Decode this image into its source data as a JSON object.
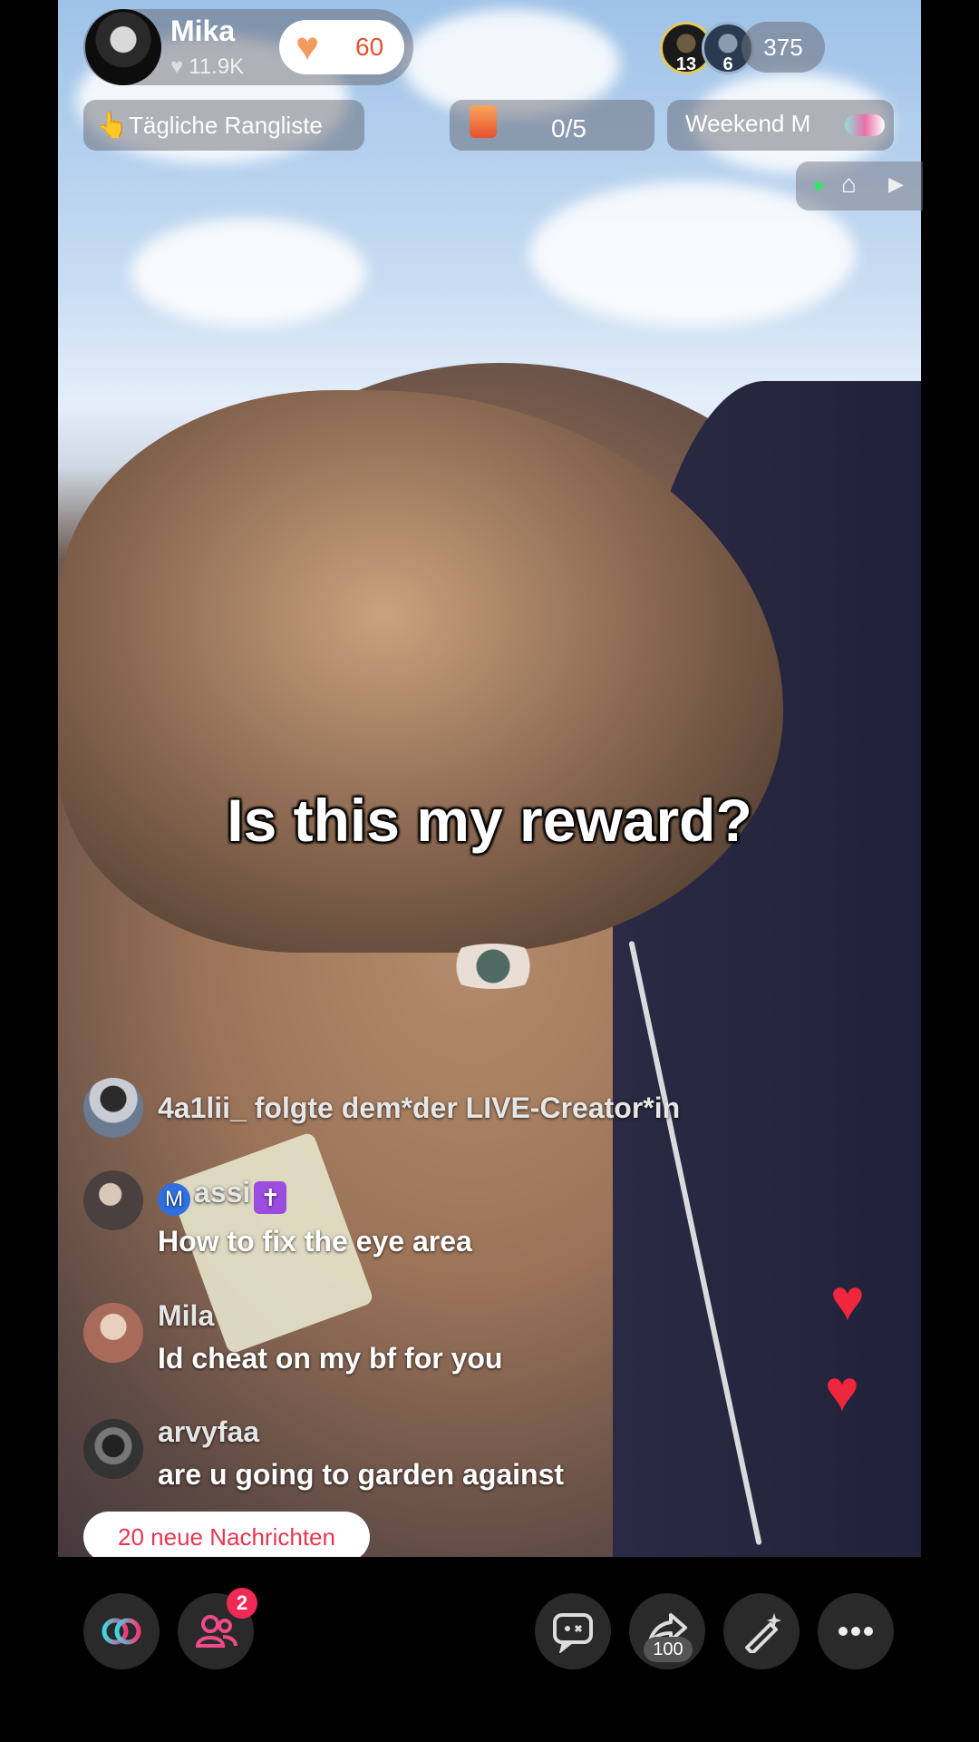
{
  "host": {
    "name": "Mika",
    "likes": "11.9K",
    "like_count": "60"
  },
  "viewers": {
    "top1_rank": "13",
    "top2_rank": "6",
    "count": "375"
  },
  "chips": {
    "ranking": "Tägliche Rangliste",
    "task_progress": "0/5",
    "weekend": "Weekend M"
  },
  "caption": "Is this my reward?",
  "comments": [
    {
      "user": "4a1lii_",
      "msg": "folgte dem*der LIVE-Creator*in"
    },
    {
      "user": "assi",
      "badge": "M",
      "msg": "How to fix the eye area"
    },
    {
      "user": "Mila",
      "msg": "Id cheat on my bf for you"
    },
    {
      "user": "arvyfaa",
      "msg": "are u going to garden against"
    }
  ],
  "new_messages": "20 neue Nachrichten",
  "bottom": {
    "friends_badge": "2",
    "share_count": "100"
  },
  "colors": {
    "accent_red": "#e8364f",
    "notif_pink": "#f02a55",
    "heart": "#f0263c",
    "like_orange": "#f59a5f"
  },
  "icons": [
    "link-icon",
    "friends-icon",
    "chat-icon",
    "share-icon",
    "magic-wand-icon",
    "more-icon",
    "heart-icon",
    "home-icon",
    "play-icon"
  ]
}
